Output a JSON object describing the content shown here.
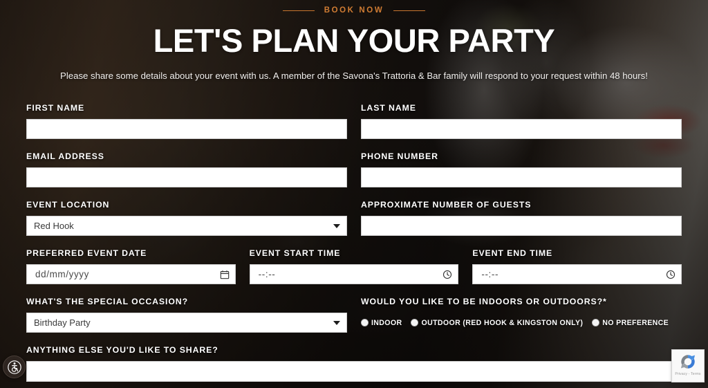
{
  "hero": {
    "eyebrow": "BOOK NOW",
    "headline": "LET'S PLAN YOUR PARTY",
    "subhead": "Please share some details about your event with us. A member of the Savona's Trattoria & Bar family will respond to your request within 48 hours!"
  },
  "colors": {
    "accent": "#d07c33",
    "text_light": "#ffffff",
    "field_bg": "#ffffff"
  },
  "form": {
    "first_name": {
      "label": "FIRST NAME",
      "value": "",
      "placeholder": ""
    },
    "last_name": {
      "label": "LAST NAME",
      "value": "",
      "placeholder": ""
    },
    "email": {
      "label": "EMAIL ADDRESS",
      "value": "",
      "placeholder": ""
    },
    "phone": {
      "label": "PHONE NUMBER",
      "value": "",
      "placeholder": ""
    },
    "event_location": {
      "label": "EVENT LOCATION",
      "selected": "Red Hook",
      "options": [
        "Red Hook"
      ]
    },
    "guests": {
      "label": "APPROXIMATE NUMBER OF GUESTS",
      "value": "",
      "placeholder": ""
    },
    "event_date": {
      "label": "PREFERRED EVENT DATE",
      "value": "",
      "placeholder": "dd/mm/yyyy",
      "icon": "calendar-icon"
    },
    "start_time": {
      "label": "EVENT START TIME",
      "value": "",
      "placeholder": "--:--",
      "icon": "clock-icon"
    },
    "end_time": {
      "label": "EVENT END TIME",
      "value": "",
      "placeholder": "--:--",
      "icon": "clock-icon"
    },
    "occasion": {
      "label": "WHAT'S THE SPECIAL OCCASION?",
      "selected": "Birthday Party",
      "options": [
        "Birthday Party"
      ]
    },
    "indoor_outdoor": {
      "label": "WOULD YOU LIKE TO BE INDOORS OR OUTDOORS?*",
      "options": [
        {
          "label": "INDOOR",
          "selected": false
        },
        {
          "label": "OUTDOOR (RED HOOK & KINGSTON ONLY)",
          "selected": false
        },
        {
          "label": "NO PREFERENCE",
          "selected": false
        }
      ]
    },
    "anything_else": {
      "label": "ANYTHING ELSE YOU'D LIKE TO SHARE?",
      "value": "",
      "placeholder": ""
    }
  },
  "widgets": {
    "accessibility": {
      "icon": "wheelchair-accessibility-icon",
      "title": "Accessibility Menu"
    },
    "recaptcha": {
      "icon": "recaptcha-logo-icon",
      "text": "Privacy - Terms"
    }
  }
}
